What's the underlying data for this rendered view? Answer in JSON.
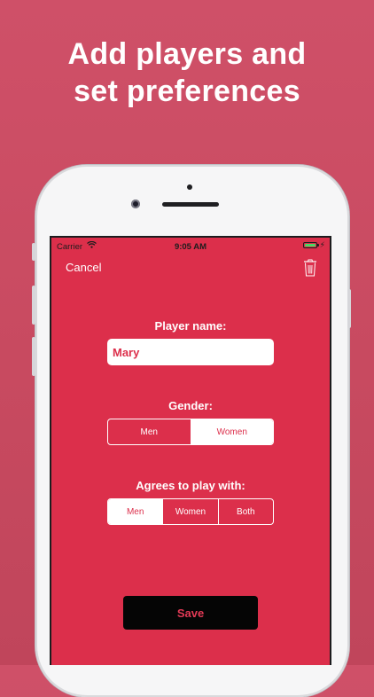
{
  "headline": {
    "line1": "Add players and",
    "line2": "set preferences"
  },
  "status_bar": {
    "carrier": "Carrier",
    "time": "9:05 AM"
  },
  "nav": {
    "cancel_label": "Cancel"
  },
  "form": {
    "player_name_label": "Player name:",
    "player_name_value": "Mary",
    "gender_label": "Gender:",
    "gender_options": [
      "Men",
      "Women"
    ],
    "gender_selected": "Women",
    "agrees_label": "Agrees to play with:",
    "agrees_options": [
      "Men",
      "Women",
      "Both"
    ],
    "agrees_selected": "Men",
    "save_label": "Save"
  },
  "colors": {
    "background": "#cf5068",
    "screen": "#dc2f4b",
    "accent_text": "#e33a56",
    "save_button": "#050505",
    "battery": "#4cd964"
  },
  "icons": [
    "wifi-icon",
    "battery-icon",
    "charging-icon",
    "trash-icon"
  ]
}
